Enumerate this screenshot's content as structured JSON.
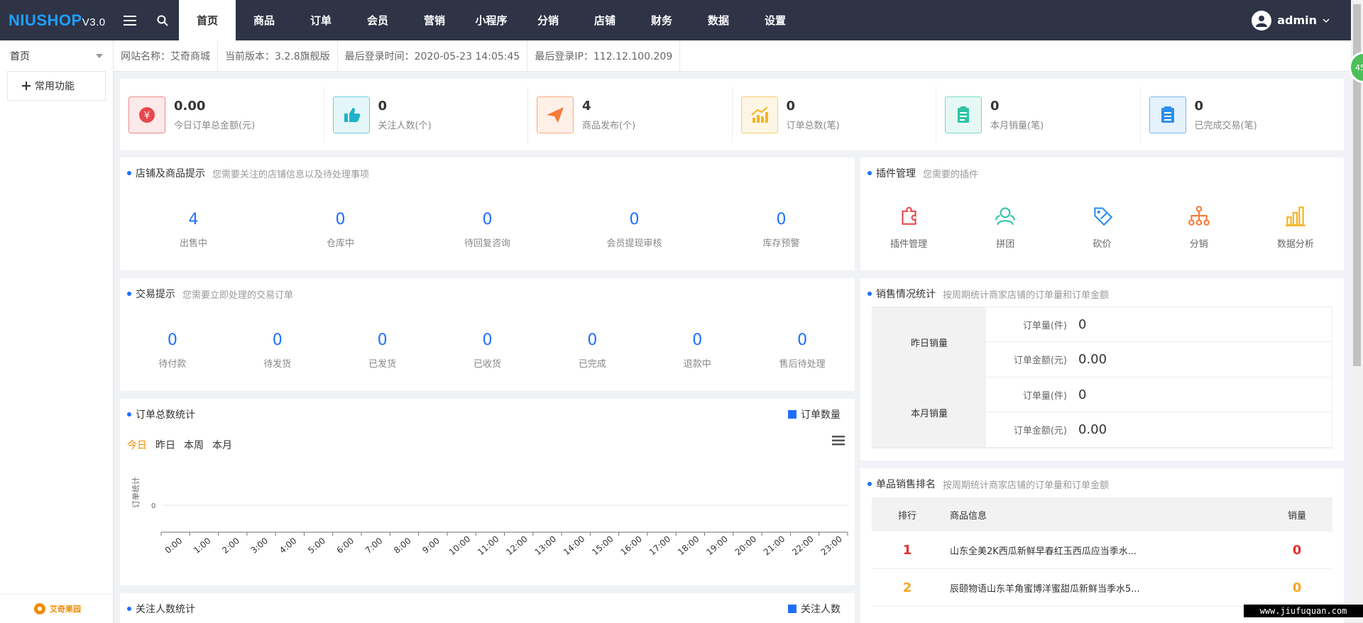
{
  "app": {
    "logo_main": "NIUSHOP",
    "logo_version": "V3.0"
  },
  "nav": [
    {
      "label": "首页",
      "active": true
    },
    {
      "label": "商品"
    },
    {
      "label": "订单"
    },
    {
      "label": "会员"
    },
    {
      "label": "营销"
    },
    {
      "label": "小程序"
    },
    {
      "label": "分销"
    },
    {
      "label": "店铺"
    },
    {
      "label": "财务"
    },
    {
      "label": "数据"
    },
    {
      "label": "设置"
    }
  ],
  "user": {
    "name": "admin"
  },
  "sidebar": {
    "current": "首页",
    "quick_button": "常用功能",
    "brand_text": "艾奇果园"
  },
  "info": {
    "site": "网站名称：艾奇商城",
    "version": "当前版本：3.2.8旗舰版",
    "last_login": "最后登录时间：2020-05-23 14:05:45",
    "last_ip": "最后登录IP：112.12.100.209"
  },
  "stats": [
    {
      "value": "0.00",
      "label": "今日订单总金额(元)",
      "icon": "money-icon",
      "color": "#e5484d"
    },
    {
      "value": "0",
      "label": "关注人数(个)",
      "icon": "thumb-up-icon",
      "color": "#1fb1c9"
    },
    {
      "value": "4",
      "label": "商品发布(个)",
      "icon": "send-icon",
      "color": "#f57c39"
    },
    {
      "value": "0",
      "label": "订单总数(笔)",
      "icon": "chart-up-icon",
      "color": "#f5b322"
    },
    {
      "value": "0",
      "label": "本月销量(笔)",
      "icon": "clipboard-icon",
      "color": "#2ec4a6"
    },
    {
      "value": "0",
      "label": "已完成交易(笔)",
      "icon": "list-icon",
      "color": "#2b8ff0"
    }
  ],
  "shop_tips": {
    "title": "店铺及商品提示",
    "subtitle": "您需要关注的店铺信息以及待处理事项",
    "items": [
      {
        "value": "4",
        "label": "出售中"
      },
      {
        "value": "0",
        "label": "仓库中"
      },
      {
        "value": "0",
        "label": "待回复咨询"
      },
      {
        "value": "0",
        "label": "会员提现审核"
      },
      {
        "value": "0",
        "label": "库存预警"
      }
    ]
  },
  "trade_tips": {
    "title": "交易提示",
    "subtitle": "您需要立即处理的交易订单",
    "items": [
      {
        "value": "0",
        "label": "待付款"
      },
      {
        "value": "0",
        "label": "待发货"
      },
      {
        "value": "0",
        "label": "已发货"
      },
      {
        "value": "0",
        "label": "已收货"
      },
      {
        "value": "0",
        "label": "已完成"
      },
      {
        "value": "0",
        "label": "退款中"
      },
      {
        "value": "0",
        "label": "售后待处理"
      }
    ]
  },
  "plugins": {
    "title": "插件管理",
    "subtitle": "您需要的插件",
    "items": [
      {
        "label": "插件管理",
        "icon": "puzzle-icon",
        "color": "#e5484d"
      },
      {
        "label": "拼团",
        "icon": "group-icon",
        "color": "#2ec4a6"
      },
      {
        "label": "砍价",
        "icon": "price-tag-icon",
        "color": "#2b8ff0"
      },
      {
        "label": "分销",
        "icon": "distribution-icon",
        "color": "#f57c39"
      },
      {
        "label": "数据分析",
        "icon": "bar-chart-icon",
        "color": "#f5b322"
      }
    ]
  },
  "sales_stats": {
    "title": "销售情况统计",
    "subtitle": "按周期统计商家店铺的订单量和订单金额",
    "blocks": [
      {
        "label": "昨日销量",
        "rows": [
          {
            "k": "订单量(件)",
            "v": "0"
          },
          {
            "k": "订单金额(元)",
            "v": "0.00"
          }
        ]
      },
      {
        "label": "本月销量",
        "rows": [
          {
            "k": "订单量(件)",
            "v": "0"
          },
          {
            "k": "订单金额(元)",
            "v": "0.00"
          }
        ]
      }
    ]
  },
  "ranking": {
    "title": "单品销售排名",
    "subtitle": "按周期统计商家店铺的订单量和订单金额",
    "headers": [
      "排行",
      "商品信息",
      "销量"
    ],
    "rows": [
      {
        "rank": "1",
        "name": "山东全美2K西瓜新鲜早春红玉西瓜应当季水...",
        "sales": "0",
        "color": "#e5302d"
      },
      {
        "rank": "2",
        "name": "辰颐物语山东羊角蜜博洋蜜甜瓜新鲜当季水5...",
        "sales": "0",
        "color": "#f5a623"
      }
    ]
  },
  "order_chart": {
    "title": "订单总数统计",
    "legend": "订单数量",
    "tabs": [
      "今日",
      "昨日",
      "本周",
      "本月"
    ],
    "active_tab": "今日",
    "ylabel": "订单统计",
    "chart_data": {
      "type": "line",
      "x": [
        "0:00",
        "1:00",
        "2:00",
        "3:00",
        "4:00",
        "5:00",
        "6:00",
        "7:00",
        "8:00",
        "9:00",
        "10:00",
        "11:00",
        "12:00",
        "13:00",
        "14:00",
        "15:00",
        "16:00",
        "17:00",
        "18:00",
        "19:00",
        "20:00",
        "21:00",
        "22:00",
        "23:00"
      ],
      "series": [
        {
          "name": "订单数量",
          "values": [
            0,
            0,
            0,
            0,
            0,
            0,
            0,
            0,
            0,
            0,
            0,
            0,
            0,
            0,
            0,
            0,
            0,
            0,
            0,
            0,
            0,
            0,
            0,
            0
          ]
        }
      ],
      "yticks": [
        "0"
      ],
      "ylabel": "订单统计",
      "legend": "top-right"
    }
  },
  "follow_chart": {
    "title": "关注人数统计",
    "legend": "关注人数"
  },
  "badge": "45",
  "watermark": "www.jiufuquan.com"
}
